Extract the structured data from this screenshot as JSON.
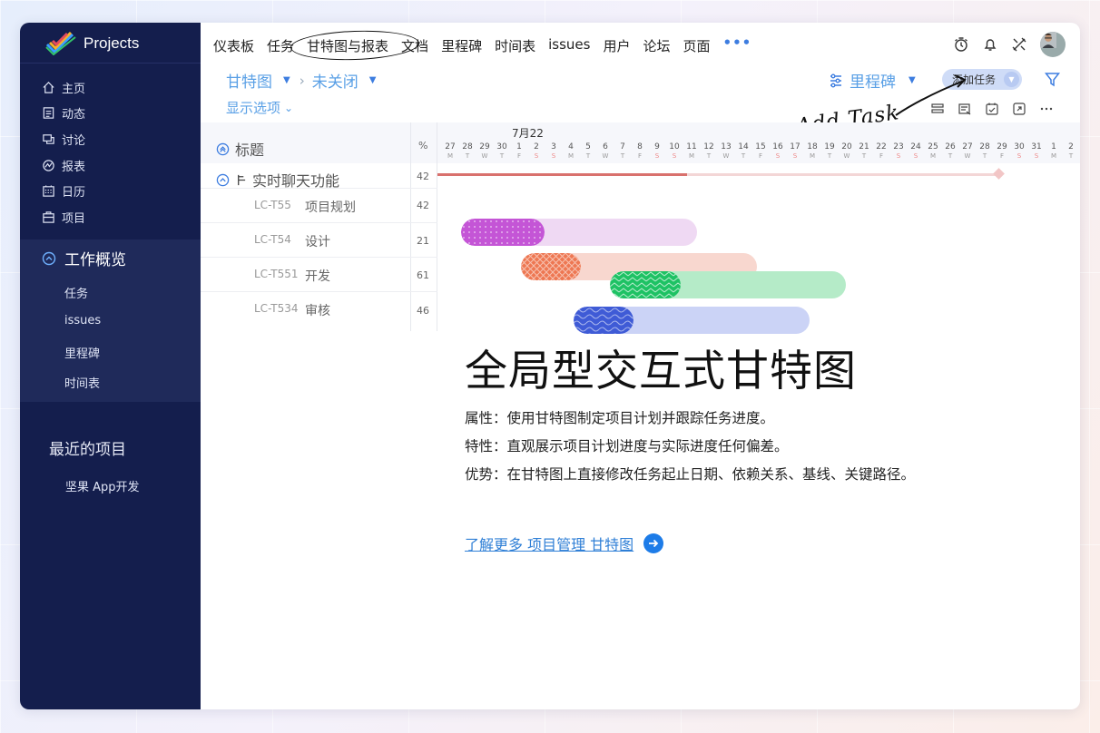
{
  "sidebar": {
    "brand": "Projects",
    "nav": [
      {
        "label": "主页",
        "icon": "home-icon"
      },
      {
        "label": "动态",
        "icon": "feed-icon"
      },
      {
        "label": "讨论",
        "icon": "chat-icon"
      },
      {
        "label": "报表",
        "icon": "report-icon"
      },
      {
        "label": "日历",
        "icon": "calendar-icon"
      },
      {
        "label": "项目",
        "icon": "project-icon"
      }
    ],
    "overview": {
      "title": "工作概览",
      "items": [
        "任务",
        "issues",
        "里程碑",
        "时间表"
      ]
    },
    "recent_title": "最近的项目",
    "recent_items": [
      "坚果 App开发"
    ]
  },
  "topnav": {
    "items": [
      "仪表板",
      "任务",
      "甘特图与报表",
      "文档",
      "里程碑",
      "时间表",
      "issues",
      "用户",
      "论坛",
      "页面"
    ],
    "more": "•••"
  },
  "toolbar": {
    "view": "甘特图",
    "sep": "›",
    "filter": "未关闭",
    "milestone": "里程碑",
    "add_task": "添加任务",
    "display_options": "显示选项",
    "annotation": "Add Task"
  },
  "gantt": {
    "col_title": "标题",
    "col_pct": "%",
    "month": "7月22",
    "days": [
      "27",
      "28",
      "29",
      "30",
      "1",
      "2",
      "3",
      "4",
      "5",
      "6",
      "7",
      "8",
      "9",
      "10",
      "11",
      "12",
      "13",
      "14",
      "15",
      "16",
      "17",
      "18",
      "19",
      "20",
      "21",
      "22",
      "23",
      "24",
      "25",
      "26",
      "27",
      "28",
      "29",
      "30",
      "31",
      "1",
      "2"
    ],
    "dows": [
      "M",
      "T",
      "W",
      "T",
      "F",
      "S",
      "S",
      "M",
      "T",
      "W",
      "T",
      "F",
      "S",
      "S",
      "M",
      "T",
      "W",
      "T",
      "F",
      "S",
      "S",
      "M",
      "T",
      "W",
      "T",
      "F",
      "S",
      "S",
      "M",
      "T",
      "W",
      "T",
      "F",
      "S",
      "S",
      "M",
      "T"
    ],
    "parent": {
      "name": "实时聊天功能",
      "pct": "42"
    },
    "rows": [
      {
        "code": "LC-T55",
        "name": "项目规划",
        "pct": "42"
      },
      {
        "code": "LC-T54",
        "name": "设计",
        "pct": "21"
      },
      {
        "code": "LC-T551",
        "name": "开发",
        "pct": "61"
      },
      {
        "code": "LC-T534",
        "name": "审核",
        "pct": "46"
      }
    ]
  },
  "bars": [
    {
      "name": "purple",
      "color": "#c455d6",
      "light": "#efd9f3"
    },
    {
      "name": "orange",
      "color": "#ee7752",
      "light": "#f8d7cf"
    },
    {
      "name": "green",
      "color": "#1ec264",
      "light": "#b5ebc8"
    },
    {
      "name": "blue",
      "color": "#3f5bd6",
      "light": "#cbd3f6"
    }
  ],
  "hero": {
    "title": "全局型交互式甘特图",
    "line1": "属性：使用甘特图制定项目计划并跟踪任务进度。",
    "line2": "特性：直观展示项目计划进度与实际进度任何偏差。",
    "line3": "优势：在甘特图上直接修改任务起止日期、依赖关系、基线、关键路径。",
    "learn_more": "了解更多 项目管理 甘特图"
  }
}
